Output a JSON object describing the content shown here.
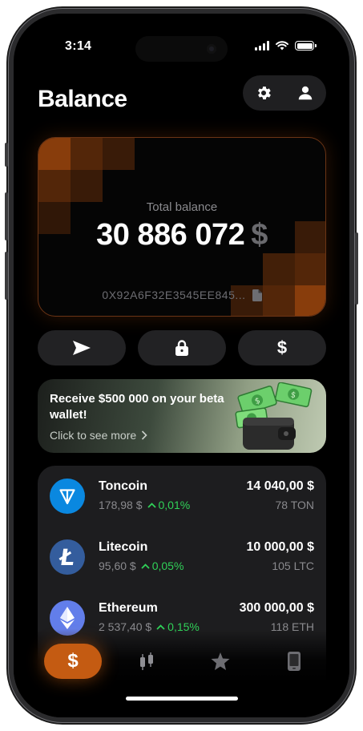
{
  "status_bar": {
    "time": "3:14"
  },
  "header": {
    "title": "Balance",
    "settings_icon": "gear-icon",
    "profile_icon": "person-icon"
  },
  "balance_card": {
    "label": "Total balance",
    "amount": "30 886 072",
    "currency": "$",
    "address": "0X92A6F32E3545EE845...",
    "accent": "#b4500f"
  },
  "actions": [
    {
      "name": "send",
      "icon": "send-icon"
    },
    {
      "name": "lock",
      "icon": "lock-icon"
    },
    {
      "name": "buy",
      "icon": "dollar-icon"
    }
  ],
  "promo": {
    "title": "Receive $500 000 on your beta wallet!",
    "cta": "Click to see more"
  },
  "assets": [
    {
      "name": "Toncoin",
      "price": "178,98 $",
      "change": "0,01%",
      "value": "14 040,00 $",
      "amount": "78 TON",
      "color": "#0a88e0"
    },
    {
      "name": "Litecoin",
      "price": "95,60 $",
      "change": "0,05%",
      "value": "10 000,00 $",
      "amount": "105 LTC",
      "color": "#345d9d"
    },
    {
      "name": "Ethereum",
      "price": "2 537,40 $",
      "change": "0,15%",
      "value": "300 000,00 $",
      "amount": "118 ETH",
      "color": "#627eea"
    }
  ],
  "tabbar": [
    {
      "name": "wallet",
      "icon": "dollar-icon",
      "active": true
    },
    {
      "name": "markets",
      "icon": "candles-icon",
      "active": false
    },
    {
      "name": "favorites",
      "icon": "star-icon",
      "active": false
    },
    {
      "name": "device",
      "icon": "phone-icon",
      "active": false
    }
  ],
  "colors": {
    "accent": "#c45b12",
    "positive": "#30d158"
  }
}
